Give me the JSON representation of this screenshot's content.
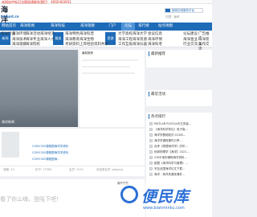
{
  "topbar": {
    "notice": "本网站中标记法版权请联系我们！ 4002403931"
  },
  "header": {
    "site_name": "海洋论坛",
    "domain": "hailunt.cn",
    "search_btn_label": "搜索在线服务平台",
    "extra": "中国 · 版块"
  },
  "nav": {
    "items": [
      "网站首页",
      "海洋新闻",
      "海洋科技",
      "海洋观察",
      "门户",
      "论坛",
      "排行榜",
      "站点地图"
    ],
    "active_index": 5
  },
  "subnav": {
    "categories": [
      "新闻",
      "服务",
      "资源"
    ],
    "links_row1": [
      "海洋行业",
      "海洋环境",
      "海洋活动",
      "海洋经济",
      "海洋特色",
      "海洋科普",
      "大学高校",
      "海洋大学",
      "会议信息",
      "论坛建议",
      "广告推广"
    ],
    "links_row2": [
      "海洋技术",
      "海洋专业",
      "海洋人才",
      "海洋教育",
      "海洋生物",
      "海洋工程",
      "海洋资源",
      "海洋环保",
      "海洋渔业",
      "海洋装备",
      "海洋管理"
    ],
    "links_row3": [
      "海洋观察",
      "海洋院校",
      "考研资料",
      "上岸经验",
      "资料共享",
      "工作互助",
      "海洋仪器",
      "海洋科考",
      "海洋数据",
      "行业交流",
      "工作交流"
    ]
  },
  "main": {
    "banner_caption": "海洋新闻",
    "featured_title": "最新推荐",
    "cards": [
      {
        "caption": "COM1302课程图海洋学资料"
      },
      {
        "caption": "COM1302课程图海洋学资料"
      }
    ],
    "card_caption_tail": "COM1302课程图海...",
    "stats": [
      "收藏: 24",
      "帖子: 17560",
      "会员: 3251",
      "欢迎新会员: gdgong"
    ],
    "comment_tip": "看了你么嗨，登陆下吧！",
    "comment_side": "最新回复"
  },
  "sidebar": {
    "blocks": [
      {
        "title": "最新推荐"
      },
      {
        "title": "最近活动"
      },
      {
        "title": "热点排行"
      }
    ],
    "hot": [
      "MATLAB R2022a中文安装...",
      "《海洋科学导论》电子版...",
      "海洋学基础知识-OCNS...",
      "海洋学课程课件分享...",
      "自考《物理海洋学》历年...",
      "地球物理学【海洋】2021...",
      "GIS中地形辅助海洋资料...",
      "欧盟《海洋科学与管理》...",
      "冬至全国海洋论文下载...",
      "海洋 · 海洋资源库课件..."
    ]
  },
  "watermark": {
    "name": "便民库",
    "url": "www.bianminku.com"
  }
}
